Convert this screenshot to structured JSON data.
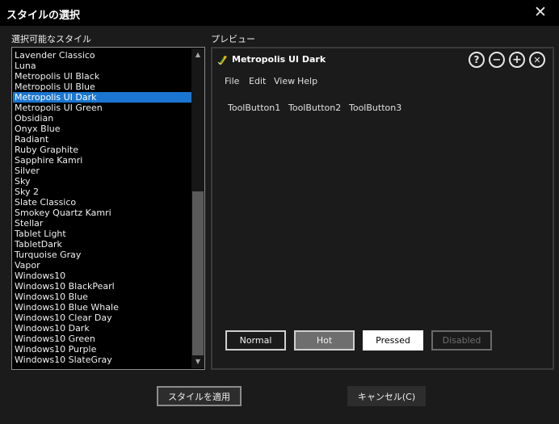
{
  "window": {
    "title": "スタイルの選択",
    "close_glyph": "✕"
  },
  "list": {
    "label": "選択可能なスタイル",
    "items": [
      "Lavender Classico",
      "Luna",
      "Metropolis UI Black",
      "Metropolis UI Blue",
      "Metropolis UI Dark",
      "Metropolis UI Green",
      "Obsidian",
      "Onyx Blue",
      "Radiant",
      "Ruby Graphite",
      "Sapphire Kamri",
      "Silver",
      "Sky",
      "Sky 2",
      "Slate Classico",
      "Smokey Quartz Kamri",
      "Stellar",
      "Tablet Light",
      "TabletDark",
      "Turquoise Gray",
      "Vapor",
      "Windows10",
      "Windows10 BlackPearl",
      "Windows10 Blue",
      "Windows10 Blue Whale",
      "Windows10 Clear Day",
      "Windows10 Dark",
      "Windows10 Green",
      "Windows10 Purple",
      "Windows10 SlateGray"
    ],
    "selected_index": 4,
    "scroll_up_glyph": "▲",
    "scroll_down_glyph": "▼"
  },
  "preview": {
    "label": "プレビュー",
    "window_title": "Metropolis UI Dark",
    "caption_buttons": [
      "?",
      "−",
      "+",
      "✕"
    ],
    "menu": [
      "File",
      "Edit",
      "View",
      "Help"
    ],
    "toolbuttons": [
      "ToolButton1",
      "ToolButton2",
      "ToolButton3"
    ],
    "buttons": {
      "normal": "Normal",
      "hot": "Hot",
      "pressed": "Pressed",
      "disabled": "Disabled"
    }
  },
  "footer": {
    "apply": "スタイルを適用",
    "cancel": "キャンセル(C)"
  },
  "colors": {
    "selection": "#1b76d2",
    "background": "#1b1b1b",
    "titlebar": "#000000"
  }
}
